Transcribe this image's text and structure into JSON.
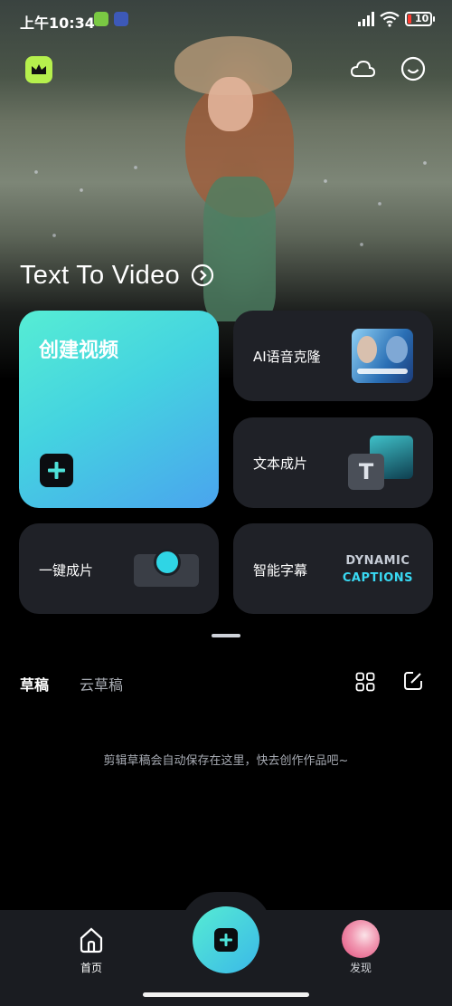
{
  "status_bar": {
    "time": "上午10:34",
    "battery": "10"
  },
  "hero": {
    "title": "Text To Video"
  },
  "cards": {
    "create_video": "创建视频",
    "ai_voice_clone": "AI语音克隆",
    "text_to_clip": "文本成片",
    "one_click": "一键成片",
    "smart_captions": "智能字幕",
    "dynamic_captions_line1": "DYNAMIC",
    "dynamic_captions_line2": "CAPTIONS"
  },
  "tabs": {
    "drafts": "草稿",
    "cloud_drafts": "云草稿"
  },
  "empty_message": "剪辑草稿会自动保存在这里，快去创作作品吧~",
  "bottom_nav": {
    "home": "首页",
    "discover": "发现"
  },
  "colors": {
    "accent_gradient_start": "#56edd4",
    "accent_gradient_end": "#4aa4ee",
    "crown_badge": "#b6f04d",
    "card_background": "#1f2127",
    "battery_low": "#ff3b30"
  },
  "icons": {
    "crown": "crown-icon",
    "cloud": "cloud-icon",
    "profile": "smile-icon",
    "grid": "grid-icon",
    "edit": "edit-icon",
    "home": "home-icon",
    "add": "plus-icon"
  }
}
